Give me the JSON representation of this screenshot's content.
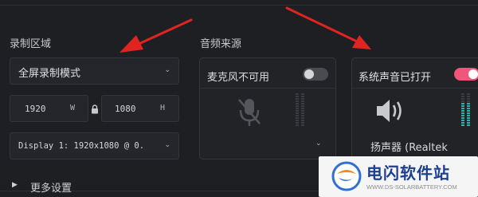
{
  "recording_area": {
    "title": "录制区域",
    "mode_value": "全屏录制模式",
    "width_value": "1920",
    "width_unit": "W",
    "height_value": "1080",
    "height_unit": "H",
    "display_value": "Display 1: 1920x1080 @ 0."
  },
  "audio_source": {
    "title": "音频来源",
    "microphone": {
      "label": "麦克风不可用",
      "enabled": false
    },
    "system_audio": {
      "label": "系统声音已打开",
      "enabled": true,
      "device_value": "扬声器 (Realtek"
    }
  },
  "more_settings": {
    "label": "更多设置"
  },
  "watermark": {
    "name": "电闪软件站",
    "url": "WWW.DS-SOLARBATTERY.COM"
  },
  "colors": {
    "accent": "#f0557a",
    "meter": "#27b3a7",
    "arrow": "#e02420",
    "toggle_off": "#4a4b50"
  }
}
